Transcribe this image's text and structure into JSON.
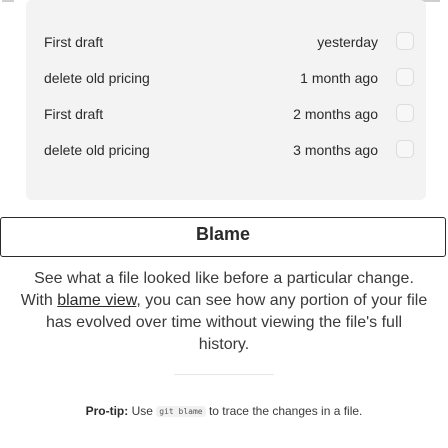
{
  "commit_history": {
    "rows": [
      {
        "message": "First draft",
        "time": "yesterday"
      },
      {
        "message": "delete old pricing",
        "time": "1 month ago"
      },
      {
        "message": "First draft",
        "time": "2 months ago"
      },
      {
        "message": "delete old pricing",
        "time": "3 months ago"
      }
    ]
  },
  "feature": {
    "title": "Blame",
    "description_before": "See what a file looked like before a particular change. With ",
    "description_link": "blame view",
    "description_after": ", you can see how any portion of your file has evolved over time without viewing the file's full history."
  },
  "pro_tip": {
    "label": "Pro-tip:",
    "before": " Use ",
    "command": "git blame",
    "after": " to trace the changes in a file."
  }
}
